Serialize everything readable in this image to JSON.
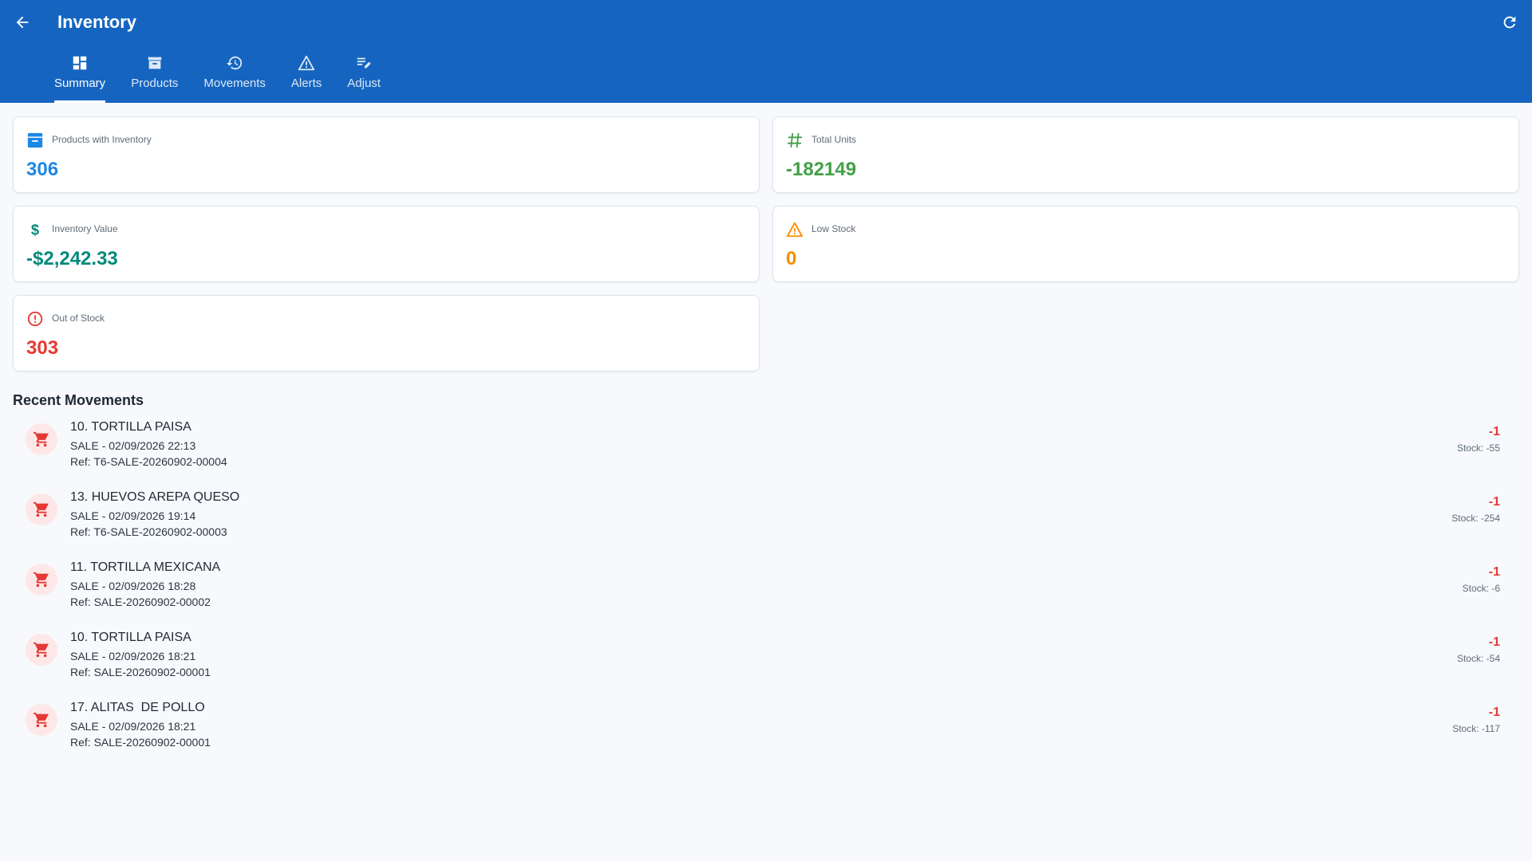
{
  "header": {
    "title": "Inventory",
    "icons": {
      "back": "arrow-left-icon",
      "refresh": "refresh-icon"
    }
  },
  "tabs": [
    {
      "label": "Summary",
      "icon": "dashboard-icon",
      "active": true
    },
    {
      "label": "Products",
      "icon": "archive-icon",
      "active": false
    },
    {
      "label": "Movements",
      "icon": "history-icon",
      "active": false
    },
    {
      "label": "Alerts",
      "icon": "warning-icon",
      "active": false
    },
    {
      "label": "Adjust",
      "icon": "edit-list-icon",
      "active": false
    }
  ],
  "cards": [
    {
      "label": "Products with Inventory",
      "value": "306",
      "color": "#1e88e5",
      "icon": "archive-icon"
    },
    {
      "label": "Total Units",
      "value": "-182149",
      "color": "#43a047",
      "icon": "hash-icon"
    },
    {
      "label": "Inventory Value",
      "value": "-$2,242.33",
      "color": "#00897b",
      "icon": "dollar-icon"
    },
    {
      "label": "Low Stock",
      "value": "0",
      "color": "#fb8c00",
      "icon": "warning-icon"
    },
    {
      "label": "Out of Stock",
      "value": "303",
      "color": "#e53935",
      "icon": "error-icon"
    }
  ],
  "recent": {
    "title": "Recent Movements",
    "items": [
      {
        "name": "10. TORTILLA PAISA",
        "sub": "SALE - 02/09/2026 22:13",
        "ref": "Ref: T6-SALE-20260902-00004",
        "qty": "-1",
        "stock": "Stock: -55"
      },
      {
        "name": "13. HUEVOS AREPA QUESO",
        "sub": "SALE - 02/09/2026 19:14",
        "ref": "Ref: T6-SALE-20260902-00003",
        "qty": "-1",
        "stock": "Stock: -254"
      },
      {
        "name": "11. TORTILLA MEXICANA",
        "sub": "SALE - 02/09/2026 18:28",
        "ref": "Ref: SALE-20260902-00002",
        "qty": "-1",
        "stock": "Stock: -6"
      },
      {
        "name": "10. TORTILLA PAISA",
        "sub": "SALE - 02/09/2026 18:21",
        "ref": "Ref: SALE-20260902-00001",
        "qty": "-1",
        "stock": "Stock: -54"
      },
      {
        "name": "17. ALITAS  DE POLLO",
        "sub": "SALE - 02/09/2026 18:21",
        "ref": "Ref: SALE-20260902-00001",
        "qty": "-1",
        "stock": "Stock: -117"
      }
    ]
  },
  "colors": {
    "primary": "#1565c0",
    "negative": "#e53935",
    "avatar_bg": "#fde8e7"
  }
}
